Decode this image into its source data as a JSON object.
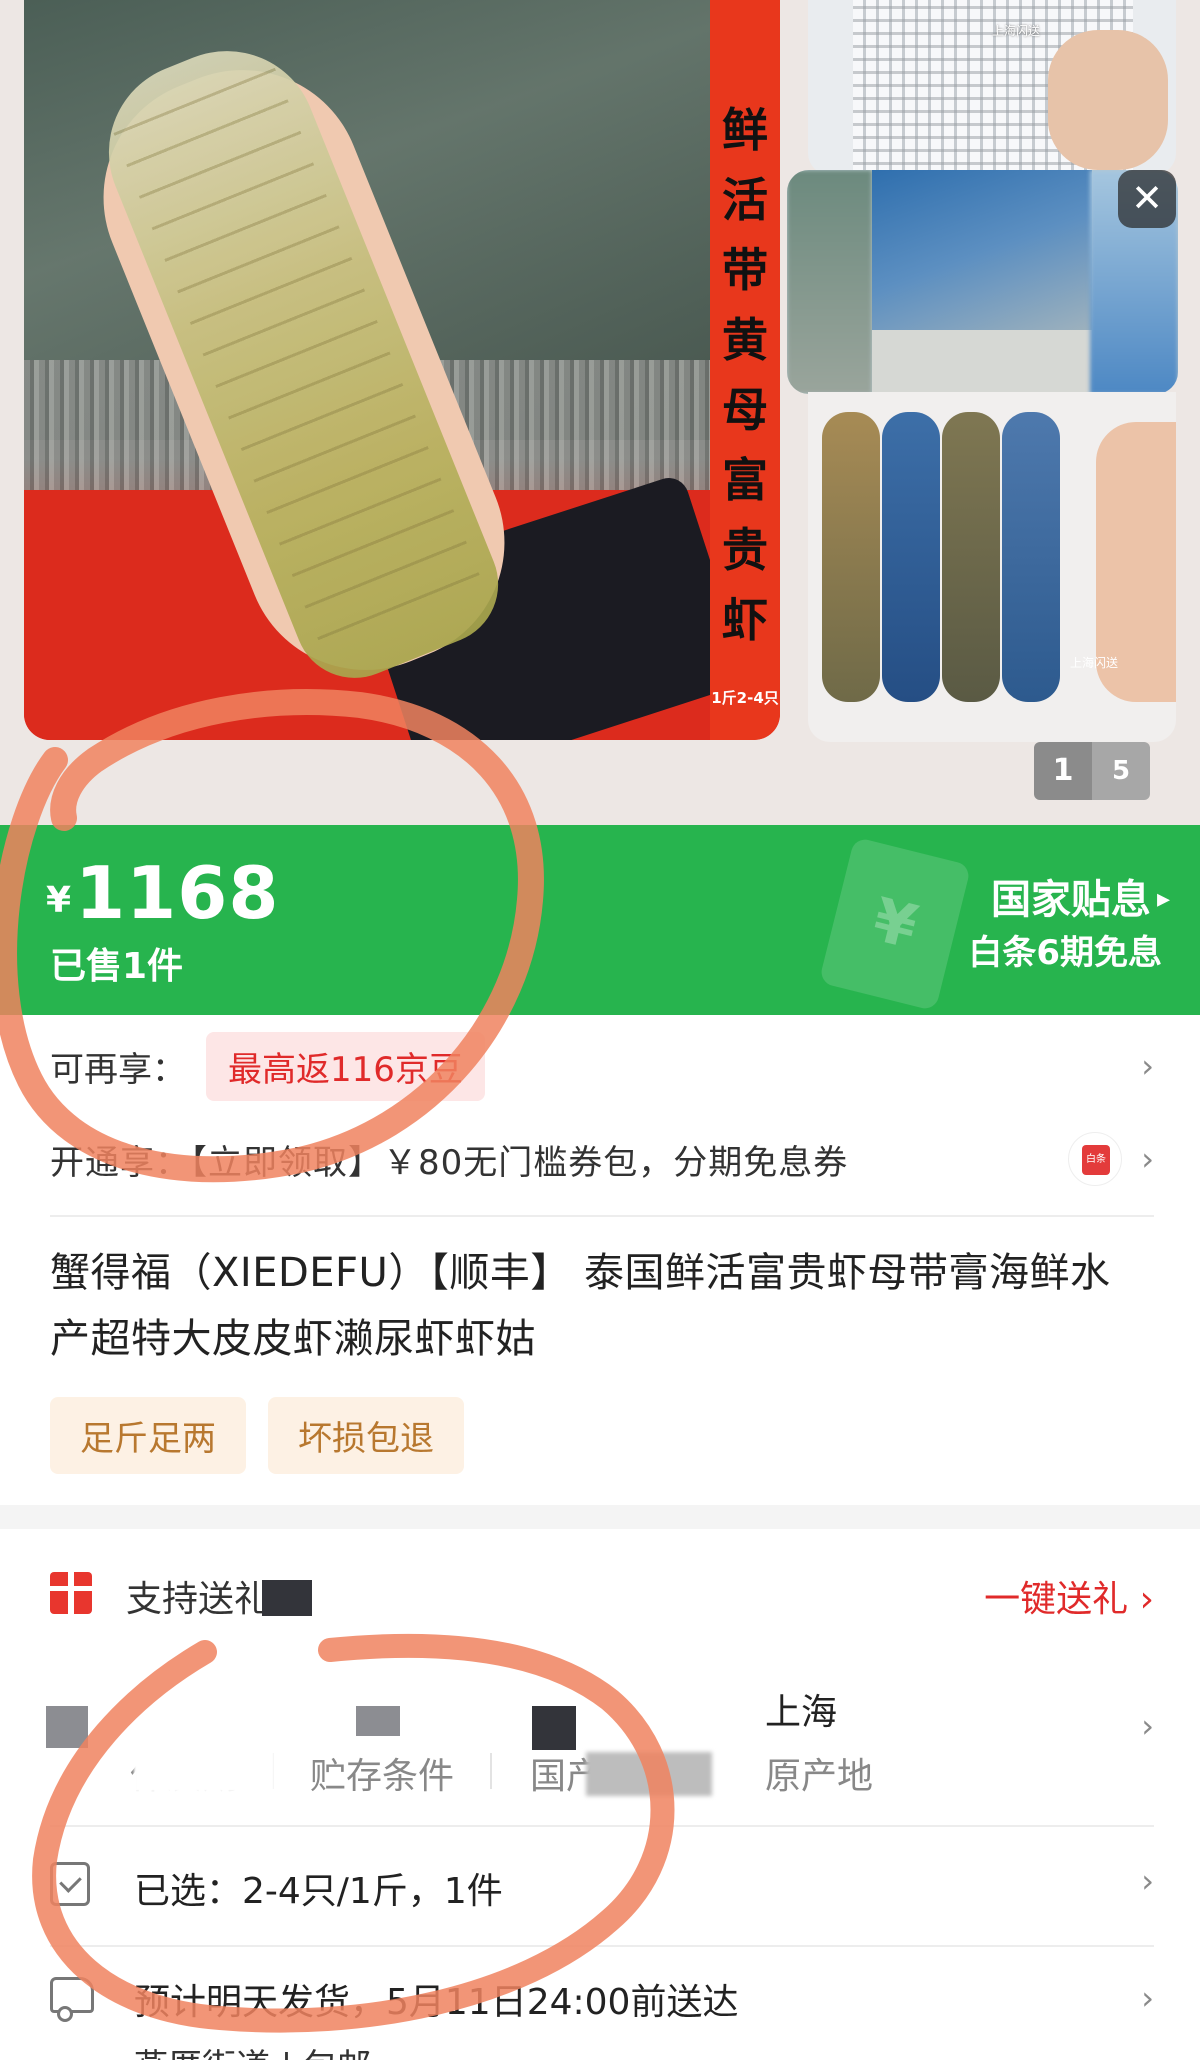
{
  "gallery": {
    "banner_text": "鲜活带黄母富贵虾",
    "banner_small": "1斤2-4只",
    "thumb_tag": "上海闪送",
    "pager_current": "1",
    "pager_total": "5",
    "close_label": "✕"
  },
  "price_bar": {
    "currency": "¥",
    "price": "1168",
    "sold": "已售1件",
    "subsidy": "国家贴息",
    "subsidy_arrow": "▸",
    "baitiao": "白条6期免息",
    "ticket_symbol": "¥"
  },
  "benefits": {
    "label": "可再享：",
    "bean": "最高返116京豆",
    "open_text": "开通享：【立即领取】￥80无门槛券包，分期免息券"
  },
  "product": {
    "title": "蟹得福（XIEDEFU）【顺丰】 泰国鲜活富贵虾母带膏海鲜水产超特大皮皮虾濑尿虾虾姑",
    "tags": [
      "足斤足两",
      "坏损包退"
    ]
  },
  "gift": {
    "text": "支持送礼物",
    "link": "一键送礼",
    "link_arrow": "›"
  },
  "specs": [
    {
      "value": "",
      "key": "保质期"
    },
    {
      "value": "",
      "key": "贮存条件"
    },
    {
      "value": "",
      "key": "国产"
    },
    {
      "value": "上海",
      "key": "原产地"
    }
  ],
  "selection": {
    "text": "已选：2-4只/1斤，1件"
  },
  "shipping": {
    "text": "预计明天发货，5月11日24:00前送达",
    "sub": "燕厝街道 | 包邮"
  },
  "chevron": "›",
  "colors": {
    "price_green": "#27b44e",
    "accent_red": "#e02a2a",
    "tag_brown": "#b8782f",
    "annotation_orange": "#f0825f"
  }
}
